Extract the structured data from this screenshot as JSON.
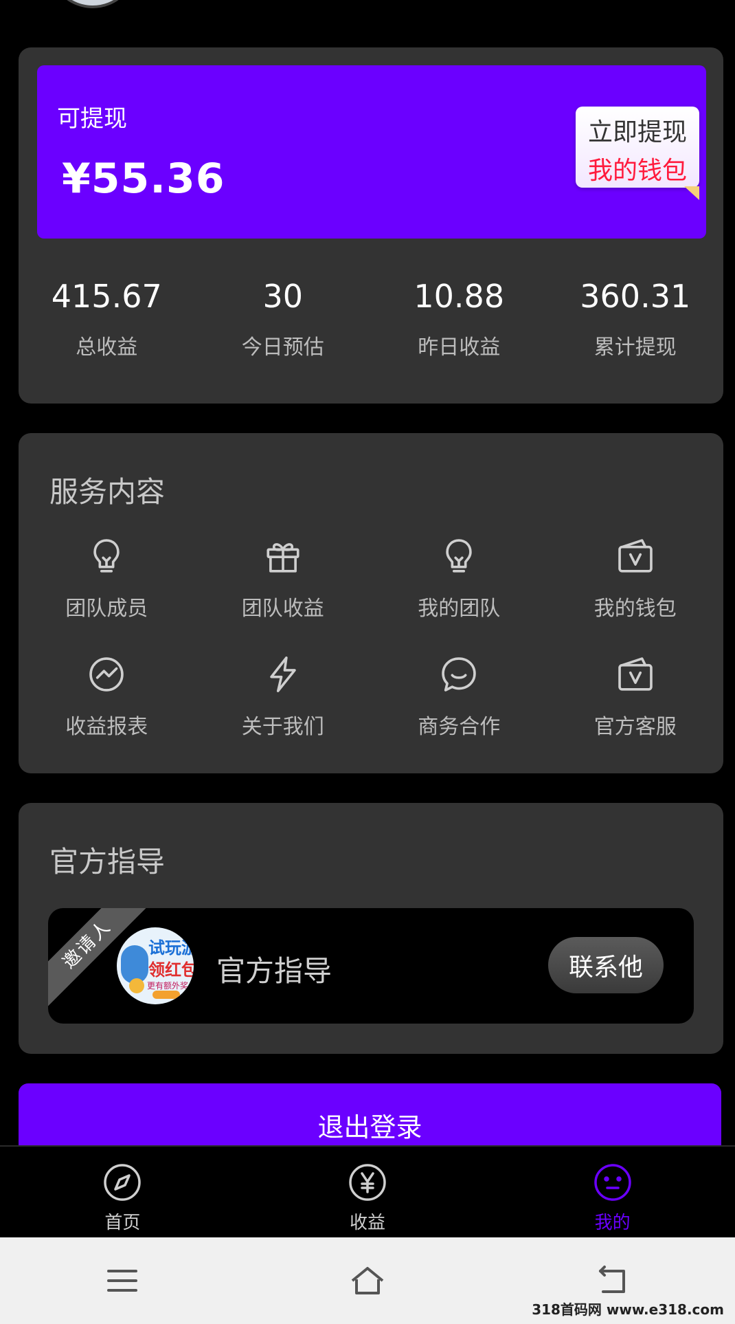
{
  "wallet": {
    "balance_label": "可提现",
    "balance_amount": "¥55.36",
    "withdraw_now": "立即提现",
    "my_wallet": "我的钱包"
  },
  "stats": [
    {
      "value": "415.67",
      "label": "总收益"
    },
    {
      "value": "30",
      "label": "今日预估"
    },
    {
      "value": "10.88",
      "label": "昨日收益"
    },
    {
      "value": "360.31",
      "label": "累计提现"
    }
  ],
  "services": {
    "title": "服务内容",
    "items": [
      {
        "label": "团队成员",
        "icon": "bulb-icon"
      },
      {
        "label": "团队收益",
        "icon": "gift-icon"
      },
      {
        "label": "我的团队",
        "icon": "bulb-icon"
      },
      {
        "label": "我的钱包",
        "icon": "wallet-icon"
      },
      {
        "label": "收益报表",
        "icon": "chart-icon"
      },
      {
        "label": "关于我们",
        "icon": "lightning-icon"
      },
      {
        "label": "商务合作",
        "icon": "chat-icon"
      },
      {
        "label": "官方客服",
        "icon": "wallet-icon"
      }
    ]
  },
  "guide": {
    "title": "官方指导",
    "ribbon": "邀请人",
    "name": "官方指导",
    "contact_label": "联系他",
    "avatar_text_1": "试玩游",
    "avatar_text_2": "领红包",
    "avatar_text_3": "更有额外奖"
  },
  "logout_label": "退出登录",
  "tabs": [
    {
      "label": "首页",
      "icon": "compass-icon"
    },
    {
      "label": "收益",
      "icon": "yen-icon"
    },
    {
      "label": "我的",
      "icon": "face-icon",
      "active": true
    }
  ],
  "accent_color": "#6b00ff",
  "watermark": "318首码网 www.e318.com"
}
